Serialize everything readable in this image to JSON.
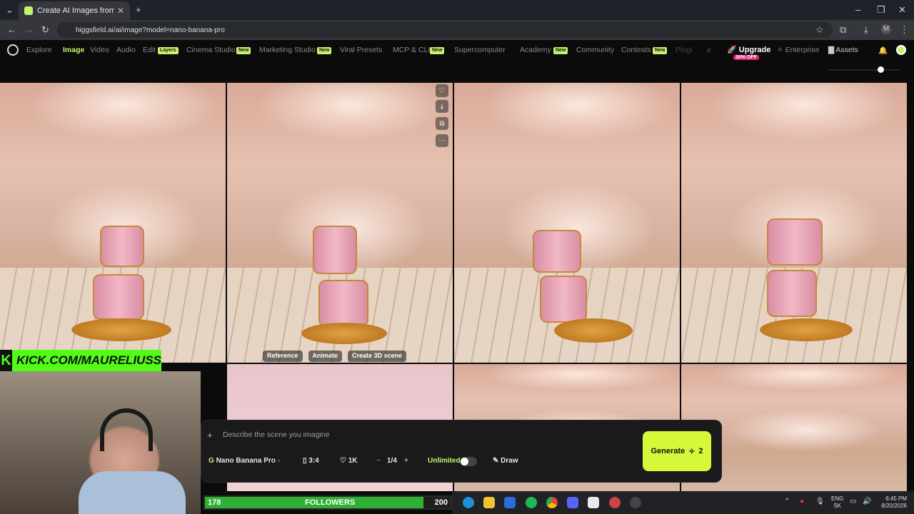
{
  "browser": {
    "tab_title": "Create AI Images from Text & P",
    "url": "higgsfield.ai/ai/image?model=nano-banana-pro"
  },
  "nav": {
    "items": [
      "Explore",
      "Image",
      "Video",
      "Audio",
      "Edit",
      "Cinema Studio",
      "Marketing Studio",
      "Viral Presets",
      "MCP & CLI",
      "Supercomputer",
      "Academy",
      "Community",
      "Contests",
      "Plugi"
    ],
    "active": "Image",
    "badges": {
      "edit": "Layers",
      "new": "New"
    },
    "upgrade": "Upgrade",
    "upgrade_badge": "30% OFF",
    "enterprise": "Enterprise",
    "assets": "Assets"
  },
  "image_toolbar": {
    "reference": "Reference",
    "animate": "Animate",
    "create3d": "Create 3D scene"
  },
  "prompt": {
    "placeholder": "Describe the scene you imagine",
    "model": "Nano Banana Pro",
    "aspect": "3:4",
    "quality": "1K",
    "count": "1/4",
    "unlimited": "Unlimited",
    "draw": "Draw",
    "generate": "Generate",
    "generate_cost": "2"
  },
  "overlay": {
    "kick": "KICK.COM/MAURELIUSS",
    "followers_left": "178",
    "followers_label": "FOLLOWERS",
    "followers_right": "200",
    "followers_progress": 0.89
  },
  "taskbar": {
    "lang_top": "ENG",
    "lang_bottom": "SK",
    "time": "6:45 PM",
    "date": "8/20/2026"
  }
}
